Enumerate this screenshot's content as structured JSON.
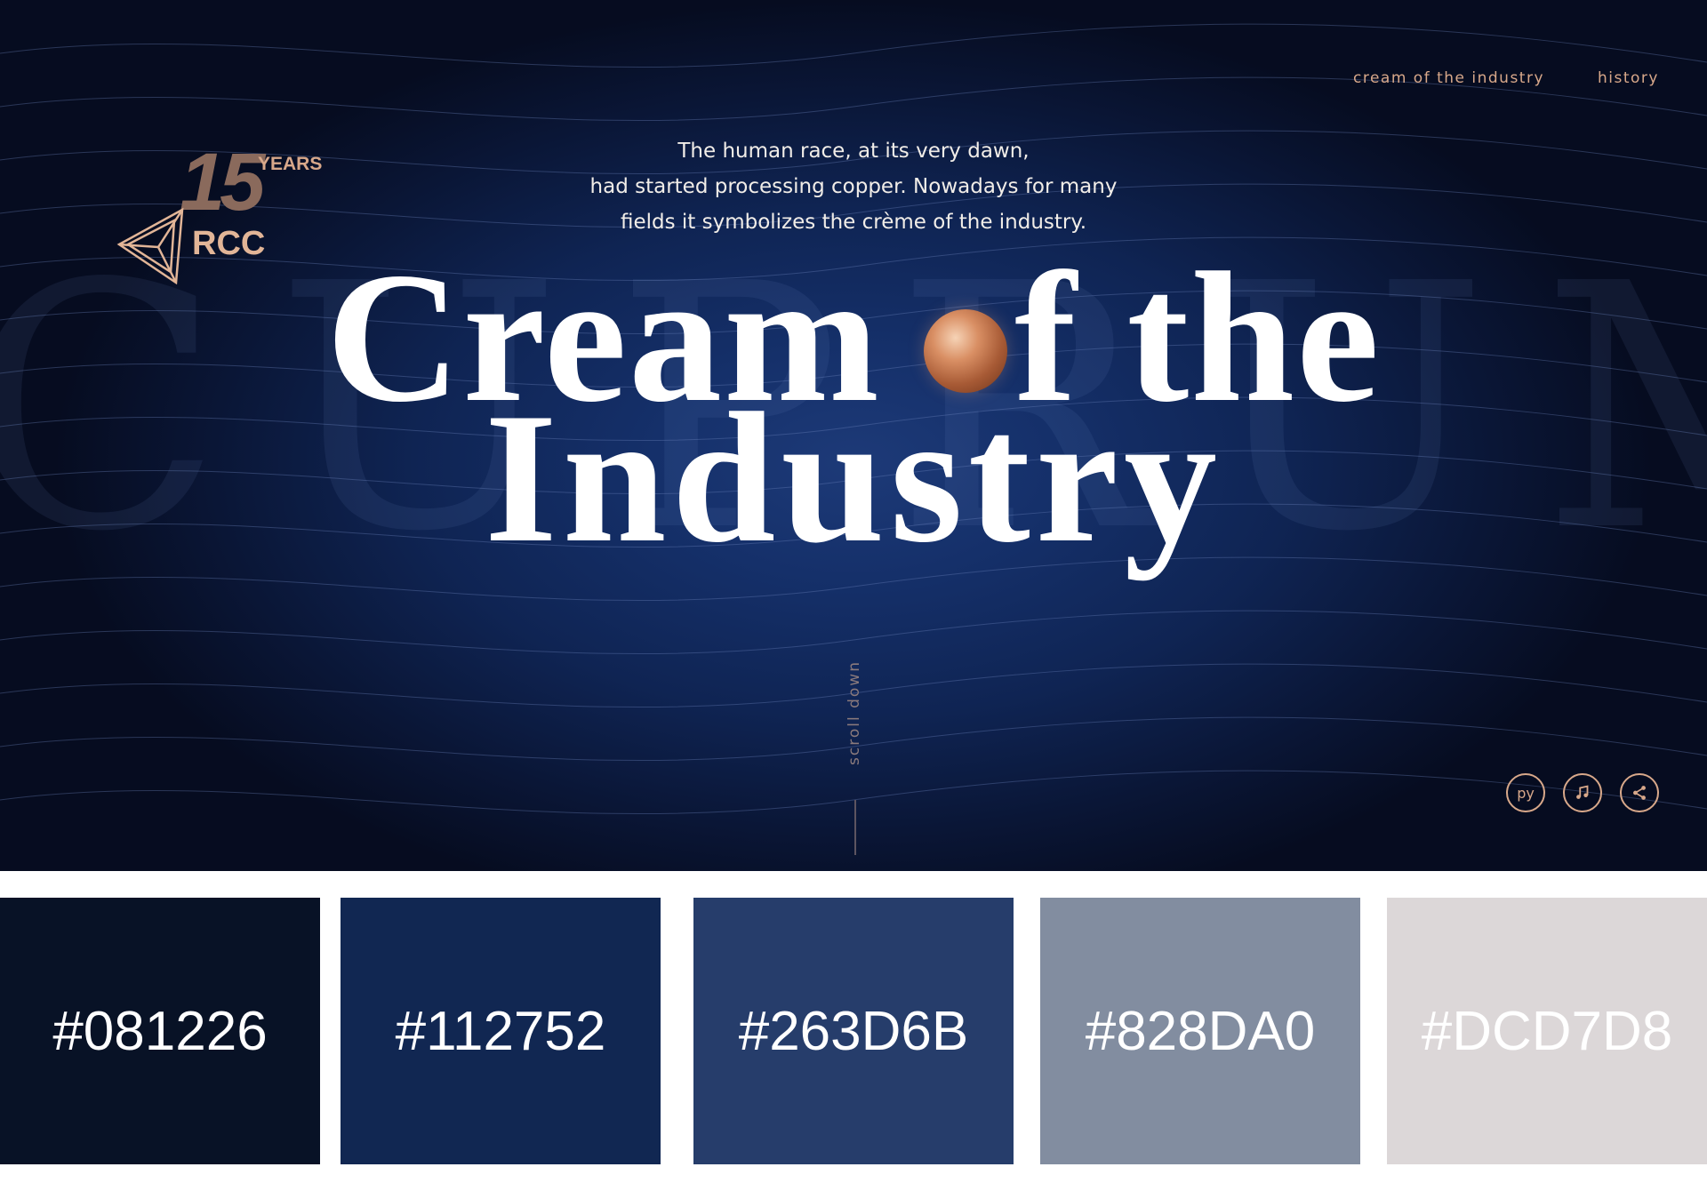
{
  "nav": {
    "items": [
      {
        "label": "cream of the industry"
      },
      {
        "label": "history"
      }
    ]
  },
  "logo": {
    "years": "YEARS",
    "number": "15",
    "name": "RCC"
  },
  "background_word": "CUPRUM",
  "intro": {
    "line1": "The human race, at its very dawn,",
    "line2": "had started processing copper. Nowadays for many",
    "line3": "fields it symbolizes the crème of the industry."
  },
  "headline": {
    "part1": "Cream",
    "part2": "f the",
    "line2": "Industry"
  },
  "scroll": {
    "label": "scroll down"
  },
  "controls": {
    "language_label": "ру",
    "icons": [
      "music-icon",
      "share-icon"
    ]
  },
  "colors": {
    "accent": "#d8a88a",
    "headline": "#ffffff"
  },
  "palette": [
    {
      "hex": "#081226",
      "label": "#081226"
    },
    {
      "hex": "#112752",
      "label": "#112752"
    },
    {
      "hex": "#263D6B",
      "label": "#263D6B"
    },
    {
      "hex": "#828DA0",
      "label": "#828DA0"
    },
    {
      "hex": "#DCD7D8",
      "label": "#DCD7D8"
    }
  ]
}
